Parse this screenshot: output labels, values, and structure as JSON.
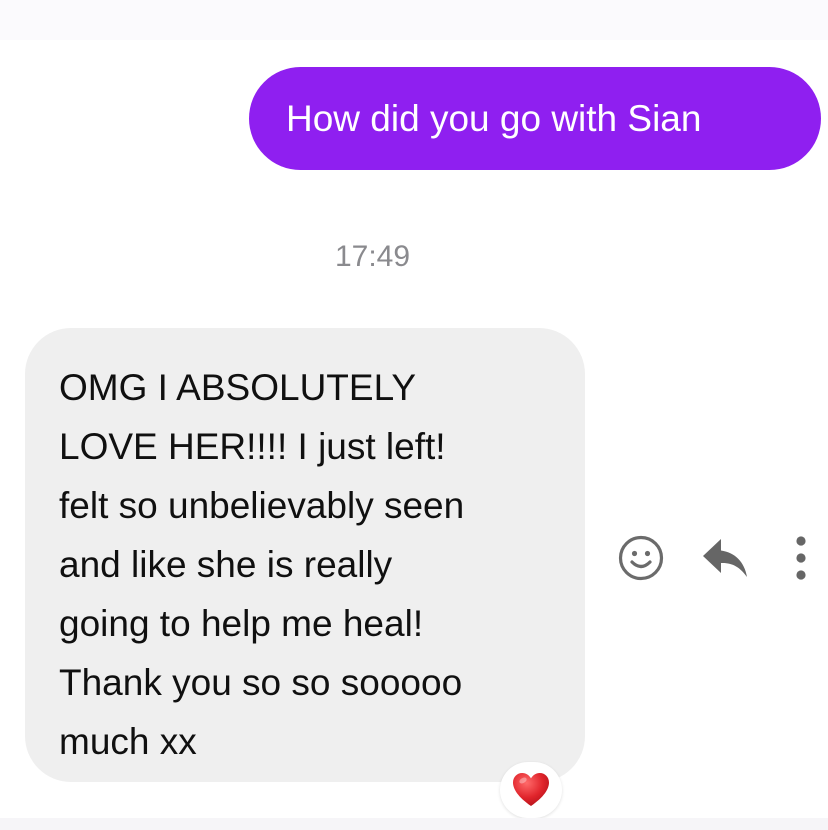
{
  "conversation": {
    "sent_message": {
      "text": "How did you go with Sian",
      "bubble_color": "#8f1ff0"
    },
    "timestamp": "17:49",
    "received_message": {
      "lines": [
        "OMG I ABSOLUTELY",
        "LOVE HER!!!! I just left!",
        "felt so unbelievably seen",
        "and like she is really",
        "going to help me heal!",
        "Thank you so so sooooo",
        "much xx"
      ],
      "bubble_color": "#efefef",
      "reaction": {
        "icon": "heart-icon",
        "color": "#e0242b"
      }
    },
    "message_actions": [
      {
        "name": "react",
        "icon": "smiley-icon"
      },
      {
        "name": "reply",
        "icon": "reply-arrow-icon"
      },
      {
        "name": "more",
        "icon": "more-vertical-icon"
      }
    ]
  }
}
